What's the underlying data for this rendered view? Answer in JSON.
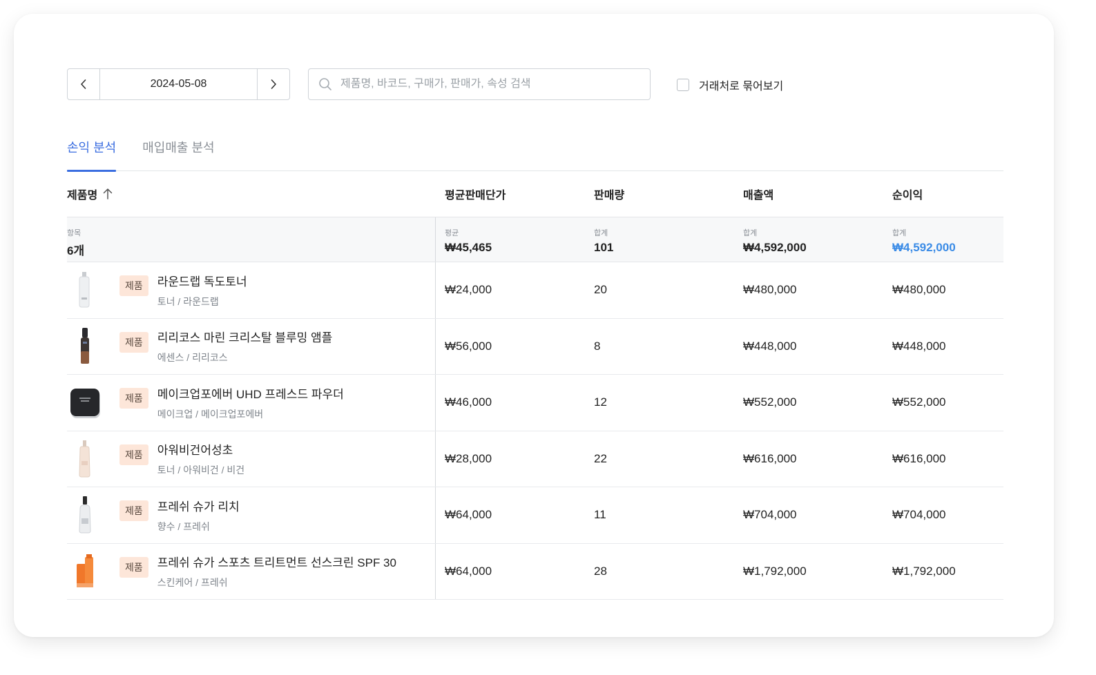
{
  "toolbar": {
    "date": "2024-05-08",
    "search_placeholder": "제품명, 바코드, 구매가, 판매가, 속성 검색",
    "group_label": "거래처로 묶어보기"
  },
  "tabs": [
    {
      "label": "손익 분석",
      "active": true
    },
    {
      "label": "매입매출 분석",
      "active": false
    }
  ],
  "table": {
    "headers": {
      "name": "제품명",
      "avg_price": "평균판매단가",
      "qty": "판매량",
      "sales": "매출액",
      "profit": "순이익"
    },
    "summary": {
      "items_label": "항목",
      "items_value": "6개",
      "avg_label": "평균",
      "avg_value": "₩45,465",
      "qty_label": "합계",
      "qty_value": "101",
      "sales_label": "합계",
      "sales_value": "₩4,592,000",
      "profit_label": "합계",
      "profit_value": "₩4,592,000"
    },
    "rows": [
      {
        "badge": "제품",
        "name": "라운드랩 독도토너",
        "category": "토너 / 라운드랩",
        "avg_price": "₩24,000",
        "qty": "20",
        "sales": "₩480,000",
        "profit": "₩480,000",
        "thumb": "toner-bottle-icon"
      },
      {
        "badge": "제품",
        "name": "리리코스 마린 크리스탈 블루밍 앰플",
        "category": "에센스 / 리리코스",
        "avg_price": "₩56,000",
        "qty": "8",
        "sales": "₩448,000",
        "profit": "₩448,000",
        "thumb": "ampoule-bottle-icon"
      },
      {
        "badge": "제품",
        "name": "메이크업포에버 UHD 프레스드 파우더",
        "category": "메이크업 / 메이크업포에버",
        "avg_price": "₩46,000",
        "qty": "12",
        "sales": "₩552,000",
        "profit": "₩552,000",
        "thumb": "powder-compact-icon"
      },
      {
        "badge": "제품",
        "name": "아워비건어성초",
        "category": "토너 / 아워비건 / 비건",
        "avg_price": "₩28,000",
        "qty": "22",
        "sales": "₩616,000",
        "profit": "₩616,000",
        "thumb": "toner-bottle-pink-icon"
      },
      {
        "badge": "제품",
        "name": "프레쉬 슈가 리치",
        "category": "향수 / 프레쉬",
        "avg_price": "₩64,000",
        "qty": "11",
        "sales": "₩704,000",
        "profit": "₩704,000",
        "thumb": "perfume-bottle-icon"
      },
      {
        "badge": "제품",
        "name": "프레쉬 슈가 스포츠 트리트먼트 선스크린 SPF 30",
        "category": "스킨케어 / 프레쉬",
        "avg_price": "₩64,000",
        "qty": "28",
        "sales": "₩1,792,000",
        "profit": "₩1,792,000",
        "thumb": "sunscreen-tube-icon"
      }
    ]
  }
}
